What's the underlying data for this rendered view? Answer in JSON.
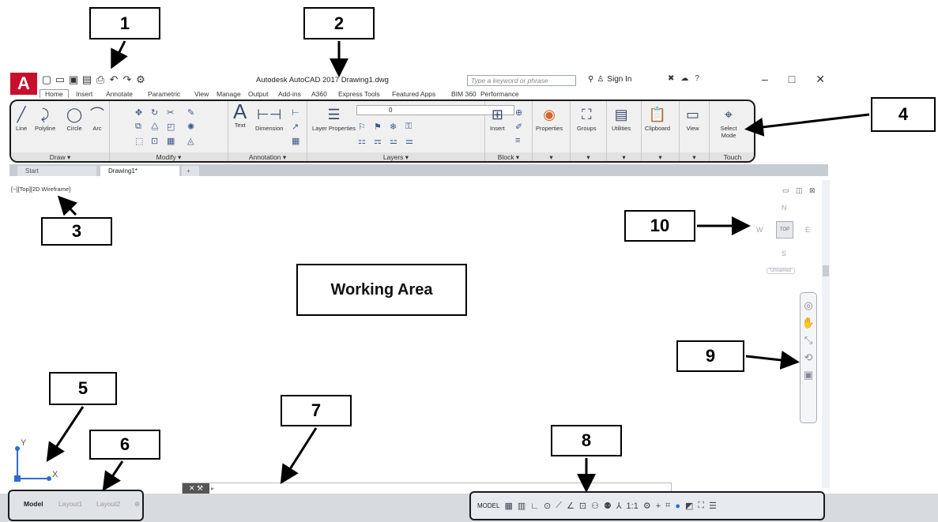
{
  "title_bar": {
    "app_logo": "A",
    "title": "Autodesk AutoCAD 2017   Drawing1.dwg",
    "search_placeholder": "Type a keyword or phrase",
    "sign_in": "Sign In",
    "window_controls": [
      "–",
      "□",
      "✕"
    ]
  },
  "ribbon_tabs": [
    "Home",
    "Insert",
    "Annotate",
    "Parametric",
    "View",
    "Manage",
    "Output",
    "Add-ins",
    "A360",
    "Express Tools",
    "Featured Apps",
    "BIM 360",
    "Performance"
  ],
  "ribbon_panels": {
    "draw": {
      "label": "Draw ▾",
      "tools": [
        "Line",
        "Polyline",
        "Circle",
        "Arc"
      ]
    },
    "modify": {
      "label": "Modify ▾"
    },
    "annotation": {
      "label": "Annotation ▾",
      "tools": [
        "Text",
        "Dimension"
      ]
    },
    "layers": {
      "label": "Layers ▾",
      "tools": [
        "Layer Properties"
      ],
      "current_layer": "0"
    },
    "block": {
      "label": "Block ▾",
      "tools": [
        "Insert"
      ]
    },
    "properties": {
      "tools": [
        "Properties"
      ]
    },
    "groups": {
      "tools": [
        "Groups"
      ]
    },
    "utilities": {
      "tools": [
        "Utilities"
      ]
    },
    "clipboard": {
      "tools": [
        "Clipboard"
      ]
    },
    "view": {
      "tools": [
        "View"
      ]
    },
    "touch": {
      "label": "Touch",
      "tools": [
        "Select Mode"
      ]
    }
  },
  "file_tabs": [
    "Start",
    "Drawing1*",
    "+"
  ],
  "viewport_label": "[−][Top][2D Wireframe]",
  "working_area_label": "Working Area",
  "viewcube": {
    "face": "TOP",
    "north": "N",
    "south": "S",
    "east": "E",
    "west": "W",
    "ucs_menu": "Unnamed"
  },
  "ucs": {
    "x": "X",
    "y": "Y"
  },
  "layout_tabs": [
    "Model",
    "Layout1",
    "Layout2"
  ],
  "status_bar": {
    "model": "MODEL",
    "scale": "1:1"
  },
  "callouts": [
    "1",
    "2",
    "3",
    "4",
    "5",
    "6",
    "7",
    "8",
    "9",
    "10"
  ],
  "colors": {
    "logo_red": "#c8102e",
    "ribbon_bg": "#f0f0f0",
    "ucs_blue": "#2f6bd1"
  },
  "icons": [
    "new-icon",
    "open-icon",
    "save-icon",
    "plot-icon",
    "undo-icon",
    "redo-icon",
    "search-icon",
    "user-icon",
    "help-icon",
    "pan-icon",
    "zoom-icon",
    "orbit-icon",
    "steering-wheel-icon",
    "showmotion-icon"
  ]
}
